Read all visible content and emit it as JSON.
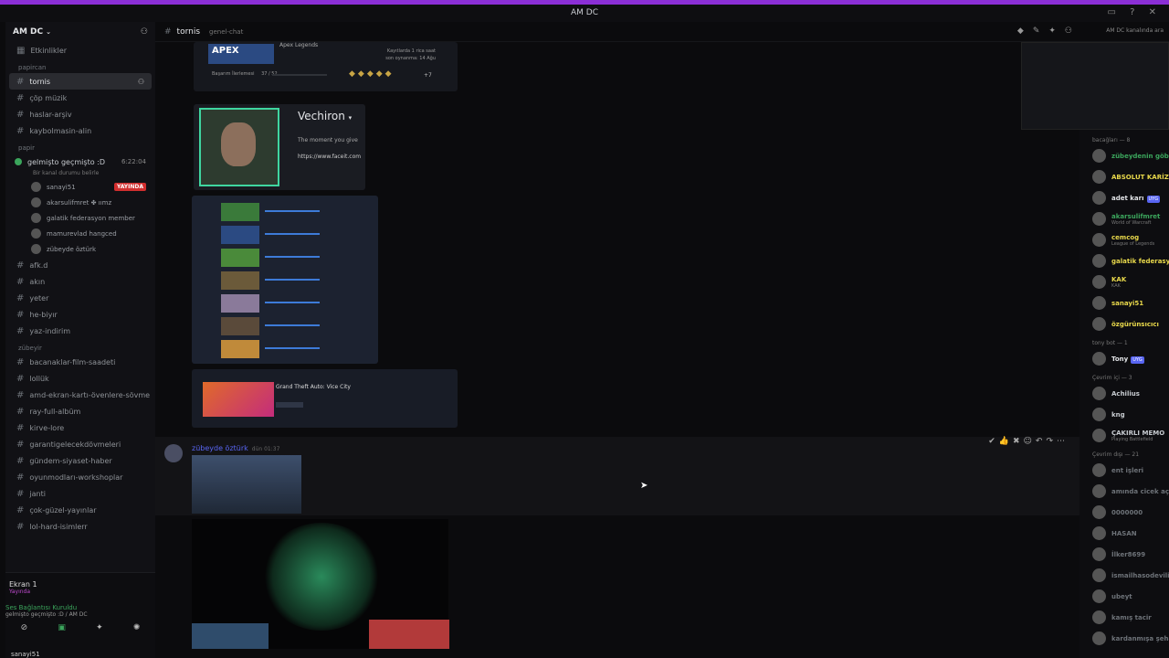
{
  "window": {
    "title": "AM DC"
  },
  "colors": {
    "accent": "#8b2fd6",
    "live": "#d12e2e",
    "online": "#3ba55c",
    "mention": "#5865f2"
  },
  "sidebar": {
    "server_name": "AM DC",
    "top_channel": "Etkinlikler",
    "categories": [
      "papircan",
      "papir",
      "zübeyir"
    ],
    "text_channels_a": [
      "tornis",
      "çöp müzik",
      "haslar-arşiv",
      "kaybolmasin-alin"
    ],
    "voice_channel": {
      "name": "gelmişto geçmişto :D",
      "time": "6:22:04",
      "status": "Bir kanal durumu belirle"
    },
    "voice_users": [
      {
        "name": "sanayi51",
        "badge": "YAYINDA"
      },
      {
        "name": "akarsulifmret ✤ ıımz"
      },
      {
        "name": "galatik federasyon member"
      },
      {
        "name": "mamurevlad hangced"
      },
      {
        "name": "zübeyde öztürk"
      }
    ],
    "text_channels_b": [
      "afk.d",
      "akın",
      "yeter",
      "he-biyır",
      "yaz-indirim"
    ],
    "text_channels_c": [
      "bacanaklar-film-saadeti",
      "lollük",
      "amd-ekran-kartı-övenlere-sövme",
      "ray-full-albüm",
      "kirve-lore",
      "garantigelecekdövmeleri",
      "gündem-siyaset-haber",
      "oyunmodları-workshoplar",
      "janti",
      "çok-güzel-yayınlar",
      "lol-hard-isimlerr"
    ]
  },
  "userpanel": {
    "screen_label": "Ekran 1",
    "screen_sub": "Yayında",
    "voice_status": "Ses Bağlantısı Kuruldu",
    "voice_sub": "gelmişto geçmişto :D / AM DC",
    "username": "sanayi51"
  },
  "header": {
    "channel": "tornis",
    "topic": "genel-chat",
    "search": "AM DC kanalında ara"
  },
  "embeds": {
    "apex_title": "APEX",
    "apex_game": "Apex Legends",
    "apex_hours": "Kayıtlarda 1 rica saat",
    "apex_last": "son oynanma: 14 Ağu",
    "achievements_label": "Başarım İlerlemesi",
    "achievements_count": "37 / 52",
    "achievements_more": "+7",
    "profile_name": "Vechiron",
    "profile_text": "The moment you give",
    "profile_link": "https://www.faceit.com",
    "gta_title": "Grand Theft Auto: Vice City"
  },
  "message": {
    "author": "zübeyde öztürk",
    "time": "dün 01:37"
  },
  "members": {
    "groups": [
      {
        "label": "bacağları — 8",
        "items": [
          {
            "name": "zübeydenin göbeği",
            "color": "#3ba55c"
          },
          {
            "name": "ABSOLUT KARİZMA",
            "color": "#e8d84b"
          },
          {
            "name": "adet karı",
            "color": "#e3e5e8",
            "badge": "UYG"
          },
          {
            "name": "akarsulifmret",
            "color": "#3ba55c",
            "sub": "World of Warcraft"
          },
          {
            "name": "cemcog",
            "color": "#e8d84b",
            "sub": "League of Legends"
          },
          {
            "name": "galatik federasyon",
            "color": "#e8d84b"
          },
          {
            "name": "KAK",
            "color": "#e8d84b",
            "sub": "KAK"
          },
          {
            "name": "sanayi51",
            "color": "#e8d84b"
          },
          {
            "name": "özgürünsıcıcı",
            "color": "#e8d84b"
          }
        ]
      },
      {
        "label": "tony bot — 1",
        "items": [
          {
            "name": "Tony",
            "color": "#e3e5e8",
            "badge": "UYG"
          }
        ]
      },
      {
        "label": "Çevrim içi — 3",
        "items": [
          {
            "name": "Achilius",
            "color": "#c7cbd0"
          },
          {
            "name": "kng",
            "color": "#c7cbd0"
          },
          {
            "name": "ÇAKIRLI MEMO",
            "color": "#c7cbd0",
            "sub": "Playing Battlefield"
          }
        ]
      },
      {
        "label": "Çevrim dışı — 21",
        "items": [
          {
            "name": "ent işleri",
            "color": "#6d7278"
          },
          {
            "name": "amında cicek aç",
            "color": "#6d7278"
          },
          {
            "name": "0000000",
            "color": "#6d7278"
          },
          {
            "name": "HASAN",
            "color": "#6d7278"
          },
          {
            "name": "İlker8699",
            "color": "#6d7278"
          },
          {
            "name": "ismailhasodevili",
            "color": "#6d7278"
          },
          {
            "name": "ubeyt",
            "color": "#6d7278"
          },
          {
            "name": "kamış tacir",
            "color": "#6d7278"
          },
          {
            "name": "kardanmışa şeha",
            "color": "#6d7278"
          }
        ]
      }
    ]
  }
}
